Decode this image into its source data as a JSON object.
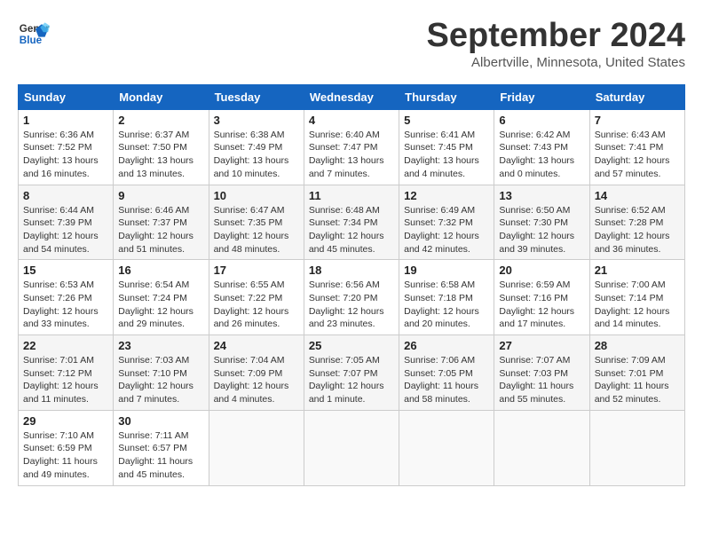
{
  "header": {
    "logo_line1": "General",
    "logo_line2": "Blue",
    "month_title": "September 2024",
    "location": "Albertville, Minnesota, United States"
  },
  "weekdays": [
    "Sunday",
    "Monday",
    "Tuesday",
    "Wednesday",
    "Thursday",
    "Friday",
    "Saturday"
  ],
  "weeks": [
    [
      {
        "day": "1",
        "sunrise": "6:36 AM",
        "sunset": "7:52 PM",
        "daylight": "13 hours and 16 minutes."
      },
      {
        "day": "2",
        "sunrise": "6:37 AM",
        "sunset": "7:50 PM",
        "daylight": "13 hours and 13 minutes."
      },
      {
        "day": "3",
        "sunrise": "6:38 AM",
        "sunset": "7:49 PM",
        "daylight": "13 hours and 10 minutes."
      },
      {
        "day": "4",
        "sunrise": "6:40 AM",
        "sunset": "7:47 PM",
        "daylight": "13 hours and 7 minutes."
      },
      {
        "day": "5",
        "sunrise": "6:41 AM",
        "sunset": "7:45 PM",
        "daylight": "13 hours and 4 minutes."
      },
      {
        "day": "6",
        "sunrise": "6:42 AM",
        "sunset": "7:43 PM",
        "daylight": "13 hours and 0 minutes."
      },
      {
        "day": "7",
        "sunrise": "6:43 AM",
        "sunset": "7:41 PM",
        "daylight": "12 hours and 57 minutes."
      }
    ],
    [
      {
        "day": "8",
        "sunrise": "6:44 AM",
        "sunset": "7:39 PM",
        "daylight": "12 hours and 54 minutes."
      },
      {
        "day": "9",
        "sunrise": "6:46 AM",
        "sunset": "7:37 PM",
        "daylight": "12 hours and 51 minutes."
      },
      {
        "day": "10",
        "sunrise": "6:47 AM",
        "sunset": "7:35 PM",
        "daylight": "12 hours and 48 minutes."
      },
      {
        "day": "11",
        "sunrise": "6:48 AM",
        "sunset": "7:34 PM",
        "daylight": "12 hours and 45 minutes."
      },
      {
        "day": "12",
        "sunrise": "6:49 AM",
        "sunset": "7:32 PM",
        "daylight": "12 hours and 42 minutes."
      },
      {
        "day": "13",
        "sunrise": "6:50 AM",
        "sunset": "7:30 PM",
        "daylight": "12 hours and 39 minutes."
      },
      {
        "day": "14",
        "sunrise": "6:52 AM",
        "sunset": "7:28 PM",
        "daylight": "12 hours and 36 minutes."
      }
    ],
    [
      {
        "day": "15",
        "sunrise": "6:53 AM",
        "sunset": "7:26 PM",
        "daylight": "12 hours and 33 minutes."
      },
      {
        "day": "16",
        "sunrise": "6:54 AM",
        "sunset": "7:24 PM",
        "daylight": "12 hours and 29 minutes."
      },
      {
        "day": "17",
        "sunrise": "6:55 AM",
        "sunset": "7:22 PM",
        "daylight": "12 hours and 26 minutes."
      },
      {
        "day": "18",
        "sunrise": "6:56 AM",
        "sunset": "7:20 PM",
        "daylight": "12 hours and 23 minutes."
      },
      {
        "day": "19",
        "sunrise": "6:58 AM",
        "sunset": "7:18 PM",
        "daylight": "12 hours and 20 minutes."
      },
      {
        "day": "20",
        "sunrise": "6:59 AM",
        "sunset": "7:16 PM",
        "daylight": "12 hours and 17 minutes."
      },
      {
        "day": "21",
        "sunrise": "7:00 AM",
        "sunset": "7:14 PM",
        "daylight": "12 hours and 14 minutes."
      }
    ],
    [
      {
        "day": "22",
        "sunrise": "7:01 AM",
        "sunset": "7:12 PM",
        "daylight": "12 hours and 11 minutes."
      },
      {
        "day": "23",
        "sunrise": "7:03 AM",
        "sunset": "7:10 PM",
        "daylight": "12 hours and 7 minutes."
      },
      {
        "day": "24",
        "sunrise": "7:04 AM",
        "sunset": "7:09 PM",
        "daylight": "12 hours and 4 minutes."
      },
      {
        "day": "25",
        "sunrise": "7:05 AM",
        "sunset": "7:07 PM",
        "daylight": "12 hours and 1 minute."
      },
      {
        "day": "26",
        "sunrise": "7:06 AM",
        "sunset": "7:05 PM",
        "daylight": "11 hours and 58 minutes."
      },
      {
        "day": "27",
        "sunrise": "7:07 AM",
        "sunset": "7:03 PM",
        "daylight": "11 hours and 55 minutes."
      },
      {
        "day": "28",
        "sunrise": "7:09 AM",
        "sunset": "7:01 PM",
        "daylight": "11 hours and 52 minutes."
      }
    ],
    [
      {
        "day": "29",
        "sunrise": "7:10 AM",
        "sunset": "6:59 PM",
        "daylight": "11 hours and 49 minutes."
      },
      {
        "day": "30",
        "sunrise": "7:11 AM",
        "sunset": "6:57 PM",
        "daylight": "11 hours and 45 minutes."
      },
      null,
      null,
      null,
      null,
      null
    ]
  ]
}
